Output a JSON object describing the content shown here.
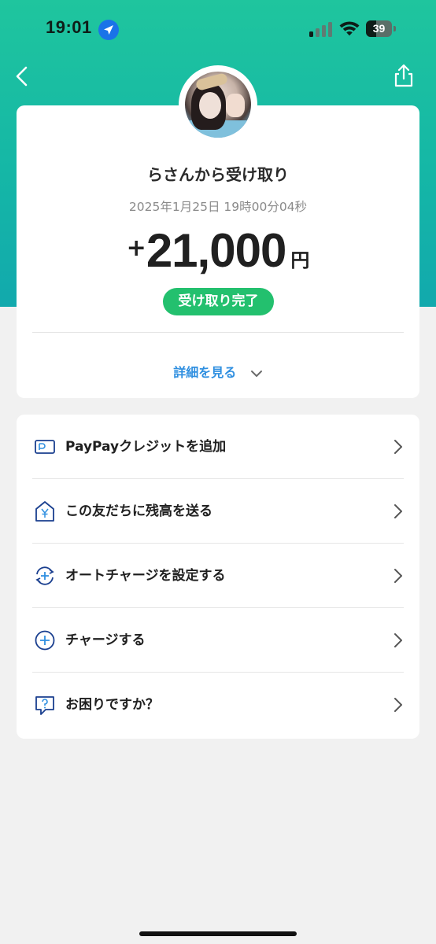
{
  "status_bar": {
    "time": "19:01",
    "battery_level": "39",
    "battery_fraction": 0.39
  },
  "transaction": {
    "title": "らさんから受け取り",
    "datetime": "2025年1月25日 19時00分04秒",
    "amount_sign": "+",
    "amount": "21,000",
    "currency": "円",
    "status": "受け取り完了",
    "details_link": "詳細を見る"
  },
  "menu": {
    "items": [
      {
        "label": "PayPayクレジットを追加",
        "icon": "credit-card-icon"
      },
      {
        "label": "この友だちに残高を送る",
        "icon": "send-yen-icon"
      },
      {
        "label": "オートチャージを設定する",
        "icon": "auto-charge-icon"
      },
      {
        "label": "チャージする",
        "icon": "plus-circle-icon"
      },
      {
        "label": "お困りですか？",
        "icon": "help-chat-icon"
      }
    ]
  },
  "colors": {
    "header_gradient_start": "#1fc59e",
    "header_gradient_end": "#12a9ad",
    "status_badge": "#23c06e",
    "link": "#2f8fe0",
    "menu_icon": "#1a3f8f"
  }
}
